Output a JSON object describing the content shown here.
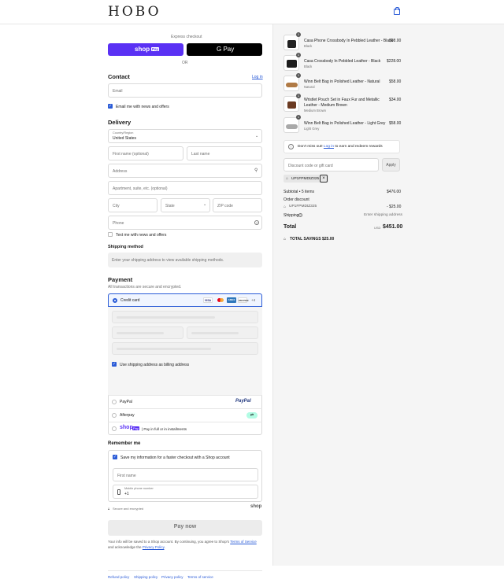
{
  "header": {
    "logo": "HOBO",
    "cart_icon": "shopping-bag-icon"
  },
  "express": {
    "title": "Express checkout",
    "shop_pay_label": "shop",
    "shop_pay_badge": "Pay",
    "google_pay_label": "G Pay",
    "or": "OR"
  },
  "contact": {
    "title": "Contact",
    "login_link": "Log in",
    "email_placeholder": "Email",
    "news_label": "Email me with news and offers"
  },
  "delivery": {
    "title": "Delivery",
    "country_label": "Country/Region",
    "country_value": "United States",
    "first_name": "First name (optional)",
    "last_name": "Last name",
    "address": "Address",
    "apartment": "Apartment, suite, etc. (optional)",
    "city": "City",
    "state": "State",
    "zip": "ZIP code",
    "phone": "Phone",
    "text_me": "Text me with news and offers"
  },
  "shipping_method": {
    "title": "Shipping method",
    "notice": "Enter your shipping address to view available shipping methods."
  },
  "payment": {
    "title": "Payment",
    "subtitle": "All transactions are secure and encrypted.",
    "credit_card": "Credit card",
    "cards": [
      "VISA",
      "MC",
      "AMEX",
      "DISCOVER"
    ],
    "more_cards": "+4",
    "billing_same": "Use shipping address as billing address",
    "paypal": "PayPal",
    "paypal_logo": "PayPal",
    "afterpay": "Afterpay",
    "shop_pay": "shop",
    "shop_pay_badge": "Pay",
    "shop_pay_desc": "| Pay in full or in installments"
  },
  "remember": {
    "title": "Remember me",
    "save_label": "Save my information for a faster checkout with a Shop account",
    "first_name": "First name",
    "mobile_label": "Mobile phone number",
    "mobile_value": "+1",
    "secure": "Secure and encrypted",
    "shop": "shop"
  },
  "pay_now": "Pay now",
  "disclaimer": {
    "text": "Your info will be saved to a Shop account. By continuing, you agree to Shop's",
    "terms": "Terms of Service",
    "and": "and acknowledge the",
    "privacy": "Privacy Policy",
    "end": "."
  },
  "footer": [
    "Refund policy",
    "Shipping policy",
    "Privacy policy",
    "Terms of service"
  ],
  "items": [
    {
      "qty": "1",
      "name": "Casa Phone Crossbody In Pebbled Leather - Black",
      "variant": "Black",
      "price": "$98.00"
    },
    {
      "qty": "1",
      "name": "Casa Crossbody In Pebbled Leather - Black",
      "variant": "Black",
      "price": "$228.00"
    },
    {
      "qty": "1",
      "name": "Winn Belt Bag in Polished Leather - Natural",
      "variant": "Natural",
      "price": "$58.00"
    },
    {
      "qty": "1",
      "name": "Wristlet Pouch Set in Faux Fur and Metallic",
      "name2": "Leather - Medium Brown",
      "variant": "Medium Brown",
      "price": "$34.00"
    },
    {
      "qty": "1",
      "name": "Winn Belt Bag in Polished Leather - Light Grey",
      "variant": "Light Grey",
      "price": "$58.00"
    }
  ],
  "rewards": {
    "pre": "Don't miss out!",
    "link": "Log in",
    "post": "to earn and redeem rewards"
  },
  "discount": {
    "placeholder": "Discount code or gift card",
    "apply": "Apply",
    "code": "UP1FPMDtZ325"
  },
  "summary": {
    "subtotal_label": "Subtotal • 5 items",
    "subtotal_value": "$476.00",
    "order_discount": "Order discount",
    "code": "UP1FPMDtZ325",
    "discount_value": "- $25.00",
    "shipping_label": "Shipping",
    "shipping_value": "Enter shipping address",
    "total_label": "Total",
    "currency": "USD",
    "total_value": "$451.00",
    "savings_label": "TOTAL SAVINGS",
    "savings_value": "$25.00"
  },
  "colors": {
    "accent": "#2a5bd7",
    "shop_pay": "#5a31f4"
  }
}
